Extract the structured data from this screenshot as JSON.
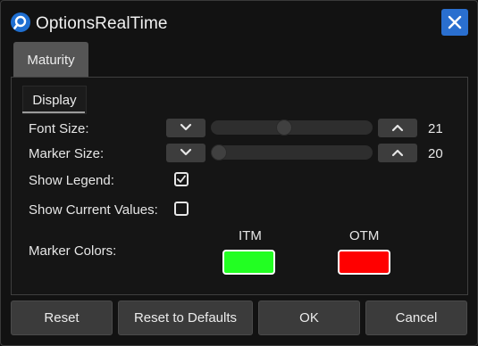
{
  "window": {
    "title": "OptionsRealTime"
  },
  "tabs": {
    "maturity": "Maturity",
    "display": "Display"
  },
  "settings": {
    "font_size": {
      "label": "Font Size:",
      "value": "21",
      "level": 0.45
    },
    "marker_size": {
      "label": "Marker Size:",
      "value": "20",
      "level": 0.0
    },
    "show_legend": {
      "label": "Show Legend:",
      "checked": true
    },
    "show_current_values": {
      "label": "Show Current Values:",
      "checked": false
    },
    "marker_colors": {
      "label": "Marker Colors:",
      "itm": {
        "label": "ITM",
        "color": "#22ff22"
      },
      "otm": {
        "label": "OTM",
        "color": "#ff0000"
      }
    }
  },
  "buttons": {
    "reset": "Reset",
    "reset_defaults": "Reset to Defaults",
    "ok": "OK",
    "cancel": "Cancel"
  },
  "colors": {
    "accent": "#2a6fcf",
    "background": "#121212"
  }
}
